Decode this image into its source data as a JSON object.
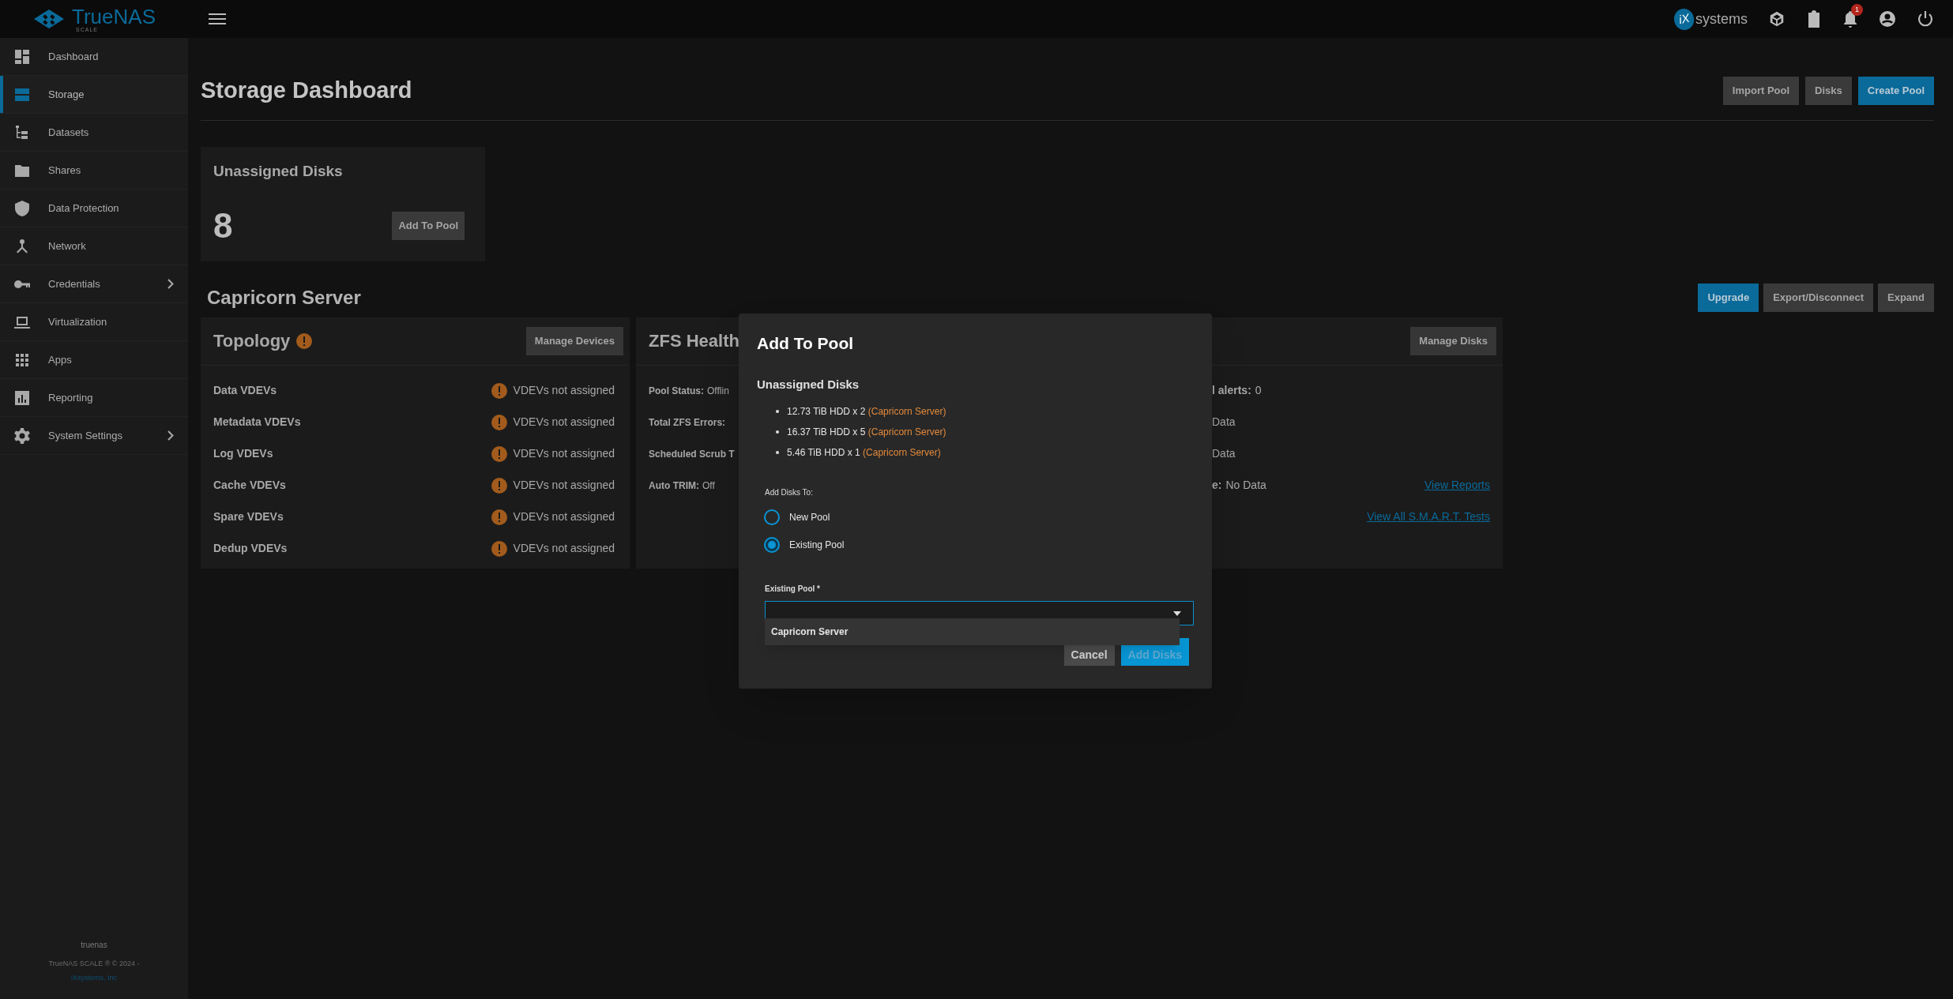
{
  "header": {
    "logo": "TrueNAS",
    "logo_sub": "SCALE",
    "vendor_mark": "iX",
    "vendor": "systems",
    "notification_count": "1"
  },
  "sidebar": {
    "items": [
      {
        "label": "Dashboard",
        "selected": false,
        "expandable": false
      },
      {
        "label": "Storage",
        "selected": true,
        "expandable": false
      },
      {
        "label": "Datasets",
        "selected": false,
        "expandable": false
      },
      {
        "label": "Shares",
        "selected": false,
        "expandable": false
      },
      {
        "label": "Data Protection",
        "selected": false,
        "expandable": false
      },
      {
        "label": "Network",
        "selected": false,
        "expandable": false
      },
      {
        "label": "Credentials",
        "selected": false,
        "expandable": true
      },
      {
        "label": "Virtualization",
        "selected": false,
        "expandable": false
      },
      {
        "label": "Apps",
        "selected": false,
        "expandable": false
      },
      {
        "label": "Reporting",
        "selected": false,
        "expandable": false
      },
      {
        "label": "System Settings",
        "selected": false,
        "expandable": true
      }
    ],
    "hostname": "truenas",
    "copyright": "TrueNAS SCALE ® © 2024 -",
    "company": "iXsystems, Inc"
  },
  "page": {
    "title": "Storage Dashboard",
    "actions": [
      {
        "label": "Import Pool",
        "primary": false
      },
      {
        "label": "Disks",
        "primary": false
      },
      {
        "label": "Create Pool",
        "primary": true
      }
    ]
  },
  "unassigned": {
    "title": "Unassigned Disks",
    "count": "8",
    "button": "Add To Pool"
  },
  "pool": {
    "name": "Capricorn Server",
    "actions": [
      {
        "label": "Upgrade",
        "primary": true
      },
      {
        "label": "Export/Disconnect",
        "primary": false
      },
      {
        "label": "Expand",
        "primary": false
      }
    ],
    "topology": {
      "title": "Topology",
      "warning": true,
      "button": "Manage Devices",
      "rows": [
        {
          "label": "Data VDEVs",
          "value": "VDEVs not assigned",
          "warning": true
        },
        {
          "label": "Metadata VDEVs",
          "value": "VDEVs not assigned",
          "warning": true
        },
        {
          "label": "Log VDEVs",
          "value": "VDEVs not assigned",
          "warning": true
        },
        {
          "label": "Cache VDEVs",
          "value": "VDEVs not assigned",
          "warning": true
        },
        {
          "label": "Spare VDEVs",
          "value": "VDEVs not assigned",
          "warning": true
        },
        {
          "label": "Dedup VDEVs",
          "value": "VDEVs not assigned",
          "warning": true
        }
      ]
    },
    "zfs_health": {
      "title": "ZFS Health",
      "rows": [
        {
          "label": "Pool Status:",
          "value": "Offlin"
        },
        {
          "label": "Total ZFS Errors:"
        },
        {
          "label": "Scheduled Scrub T"
        },
        {
          "label": "Auto TRIM:",
          "value": "Off"
        }
      ]
    },
    "disk_health": {
      "button": "Manage Disks",
      "rows": [
        {
          "label": "l alerts:",
          "value": "0"
        },
        {
          "value": "Data"
        },
        {
          "value": "Data"
        },
        {
          "label": "e:",
          "value": "No Data",
          "link": "View Reports"
        },
        {
          "link": "View All S.M.A.R.T. Tests"
        }
      ]
    }
  },
  "dialog": {
    "title": "Add To Pool",
    "section": "Unassigned Disks",
    "disks": [
      {
        "size": "12.73 TiB HDD x 2",
        "pool": "(Capricorn Server)"
      },
      {
        "size": "16.37 TiB HDD x 5",
        "pool": "(Capricorn Server)"
      },
      {
        "size": "5.46 TiB HDD x 1",
        "pool": "(Capricorn Server)"
      }
    ],
    "radio_label": "Add Disks To:",
    "options": [
      {
        "label": "New Pool",
        "selected": false
      },
      {
        "label": "Existing Pool",
        "selected": true
      }
    ],
    "select": {
      "label": "Existing Pool *",
      "open": true,
      "options": [
        "Capricorn Server"
      ]
    },
    "buttons": [
      {
        "label": "Cancel",
        "kind": "secondary",
        "disabled": false
      },
      {
        "label": "Add Disks",
        "kind": "primary",
        "disabled": true
      }
    ]
  }
}
